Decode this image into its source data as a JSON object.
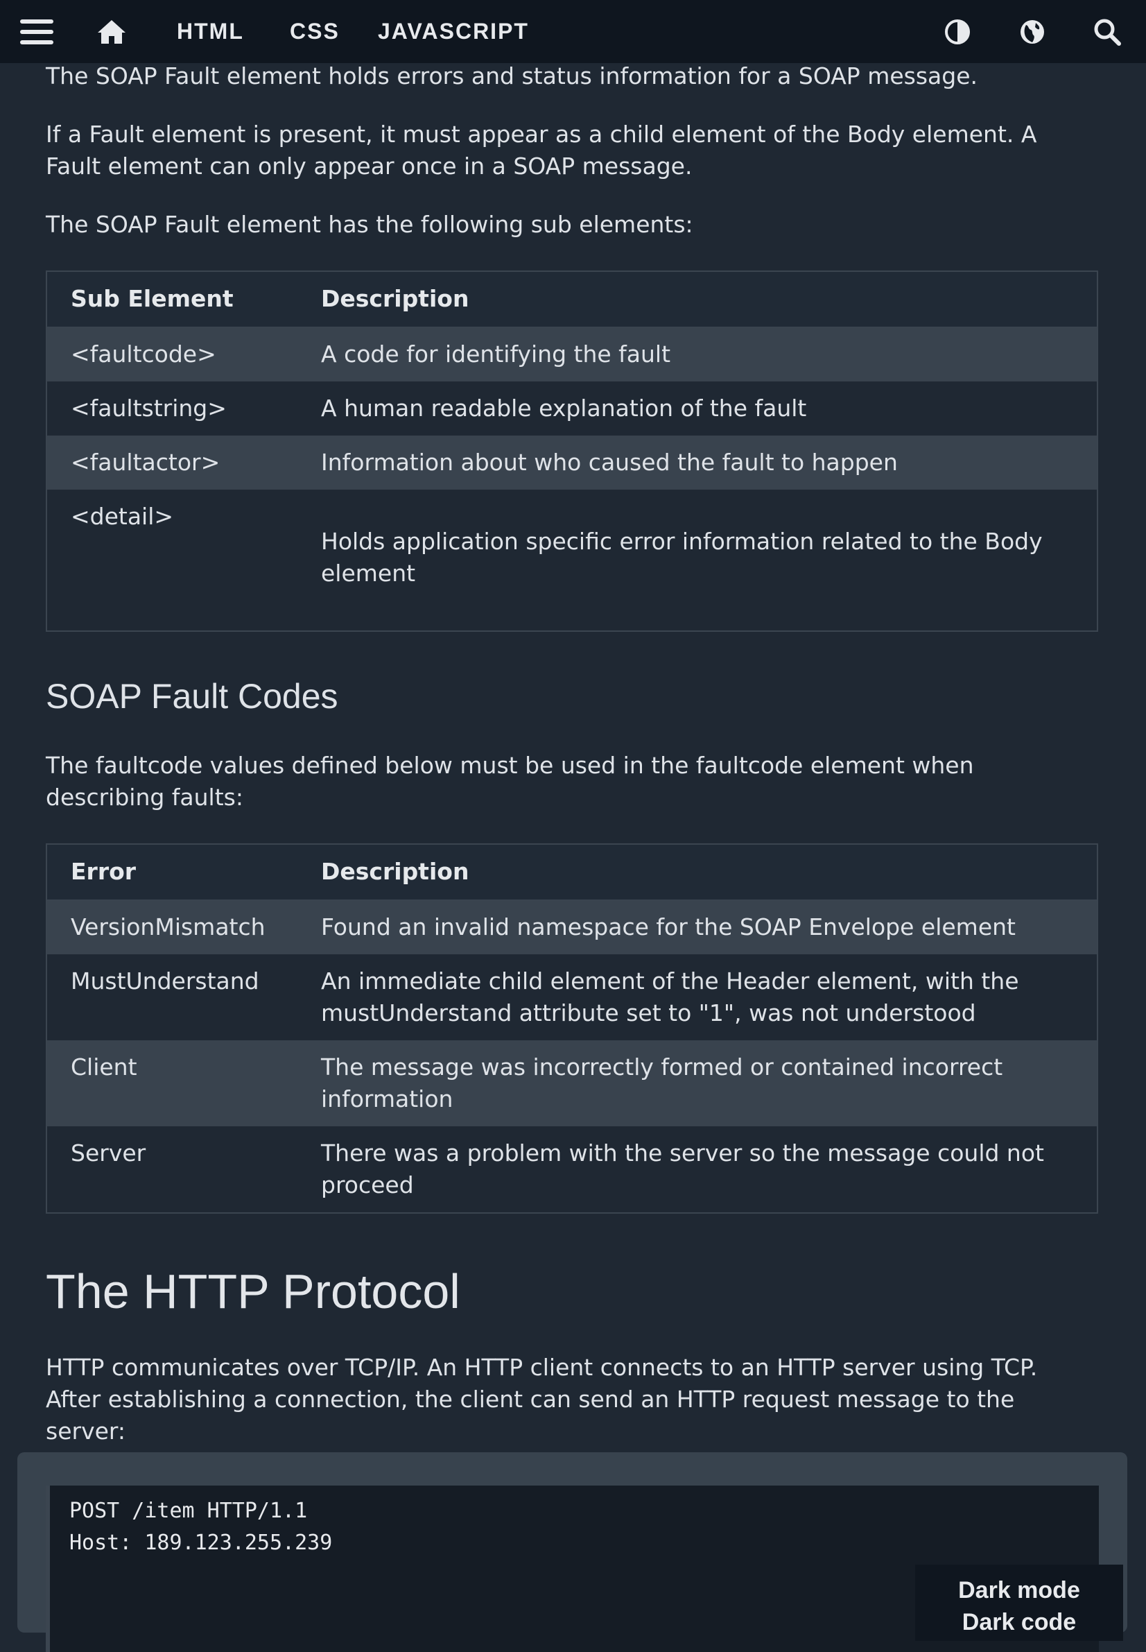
{
  "nav": {
    "links": [
      "HTML",
      "CSS",
      "JAVASCRIPT"
    ],
    "icons": [
      "menu-icon",
      "home-icon",
      "contrast-icon",
      "globe-icon",
      "search-icon"
    ]
  },
  "intro": {
    "p1": "The SOAP Fault element holds errors and status information for a SOAP message.",
    "p2": "If a Fault element is present, it must appear as a child element of the Body element. A Fault element can only appear once in a SOAP message.",
    "p3": "The SOAP Fault element has the following sub elements:"
  },
  "sub_table": {
    "headers": [
      "Sub Element",
      "Description"
    ],
    "rows": [
      [
        "<faultcode>",
        "A code for identifying the fault"
      ],
      [
        "<faultstring>",
        "A human readable explanation of the fault"
      ],
      [
        "<faultactor>",
        "Information about who caused the fault to happen"
      ],
      [
        "<detail>",
        "Holds application specific error information related to the Body element"
      ]
    ]
  },
  "fault_codes": {
    "heading": "SOAP Fault Codes",
    "intro": "The faultcode values defined below must be used in the faultcode element when describing faults:",
    "headers": [
      "Error",
      "Description"
    ],
    "rows": [
      [
        "VersionMismatch",
        "Found an invalid namespace for the SOAP Envelope element"
      ],
      [
        "MustUnderstand",
        "An immediate child element of the Header element, with the mustUnderstand attribute set to \"1\", was not understood"
      ],
      [
        "Client",
        "The message was incorrectly formed or contained incorrect information"
      ],
      [
        "Server",
        "There was a problem with the server so the message could not proceed"
      ]
    ]
  },
  "http": {
    "heading": "The HTTP Protocol",
    "intro": "HTTP communicates over TCP/IP. An HTTP client connects to an HTTP server using TCP. After establishing a connection, the client can send an HTTP request message to the server:",
    "code": [
      "POST /item HTTP/1.1",
      "Host: 189.123.255.239"
    ]
  },
  "darkmode": {
    "label": "Dark mode",
    "label2": "Dark code"
  },
  "colors": {
    "background": "#1f2833",
    "topbar": "#0f161f",
    "row_shaded": "#39434e",
    "code_bg": "#151c25"
  }
}
